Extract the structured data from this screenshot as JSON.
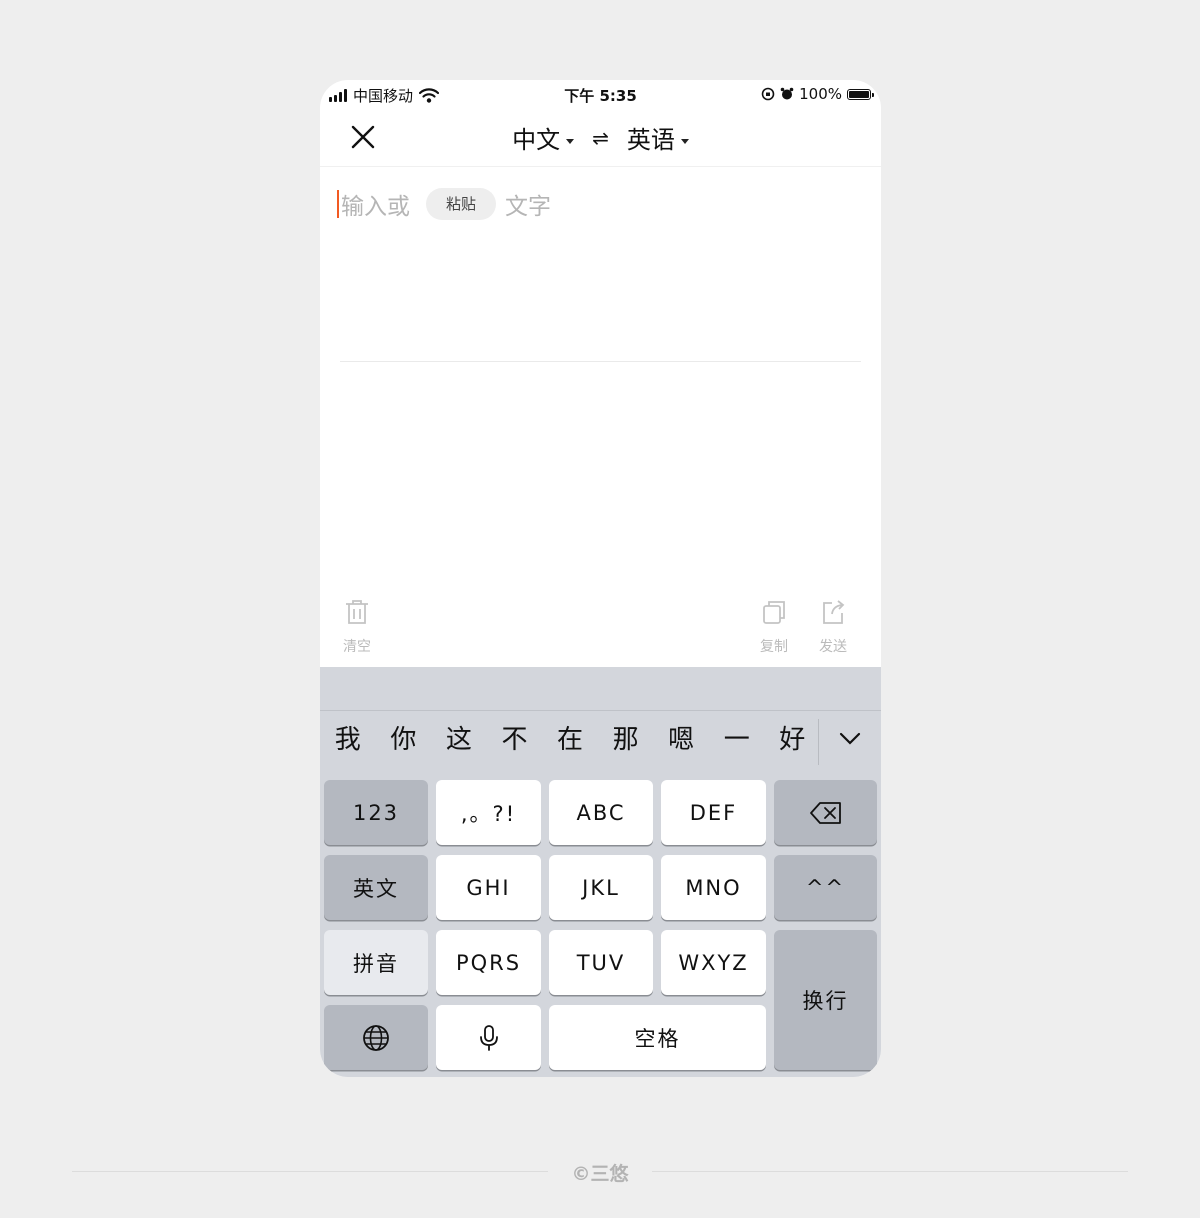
{
  "status_bar": {
    "carrier": "中国移动",
    "time": "下午 5:35",
    "battery": "100%"
  },
  "nav": {
    "source_lang": "中文",
    "target_lang": "英语",
    "swap_symbol": "⇌"
  },
  "input": {
    "placeholder_before": "输入或",
    "paste_label": "粘贴",
    "placeholder_after": "文字"
  },
  "toolbar": {
    "clear_label": "清空",
    "copy_label": "复制",
    "send_label": "发送"
  },
  "keyboard": {
    "candidates": [
      "我",
      "你",
      "这",
      "不",
      "在",
      "那",
      "嗯",
      "一",
      "好"
    ],
    "keys": {
      "num": "123",
      "punct": ",。?!",
      "abc": "ABC",
      "def": "DEF",
      "english": "英文",
      "ghi": "GHI",
      "jkl": "JKL",
      "mno": "MNO",
      "emoticon": "^^",
      "pinyin": "拼音",
      "pqrs": "PQRS",
      "tuv": "TUV",
      "wxyz": "WXYZ",
      "return": "换行",
      "space": "空格"
    }
  },
  "footer": {
    "credit": "©三悠"
  },
  "colors": {
    "cursor": "#f25a22",
    "keyboard_bg": "#d3d6dc",
    "page_bg": "#eeeeee"
  }
}
